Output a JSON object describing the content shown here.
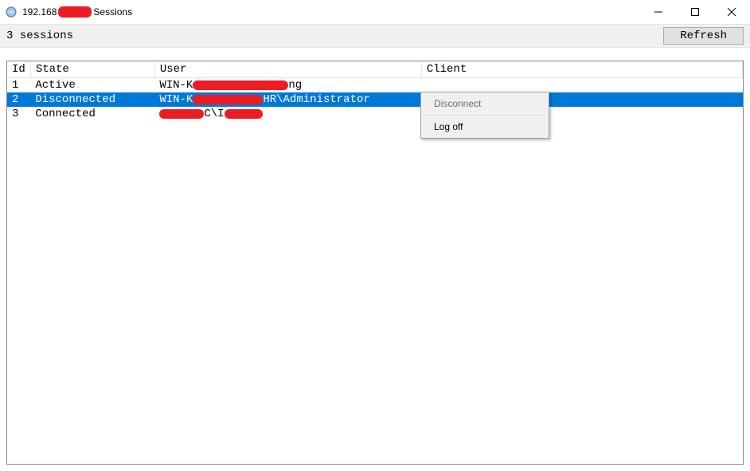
{
  "window": {
    "ip_prefix": "192.168",
    "title_suffix": " Sessions"
  },
  "toolbar": {
    "session_count_label": "3 sessions",
    "refresh_label": "Refresh"
  },
  "columns": {
    "id": "Id",
    "state": "State",
    "user": "User",
    "client": "Client"
  },
  "rows": [
    {
      "id": "1",
      "state": "Active",
      "user_prefix": "WIN-K",
      "user_suffix": "ng",
      "client": "",
      "selected": false
    },
    {
      "id": "2",
      "state": "Disconnected",
      "user_prefix": "WIN-K",
      "user_suffix": "HR\\Administrator",
      "client": "",
      "selected": true
    },
    {
      "id": "3",
      "state": "Connected",
      "user_prefix": "",
      "user_suffix": "",
      "client": "",
      "selected": false
    }
  ],
  "context_menu": {
    "disconnect": "Disconnect",
    "logoff": "Log off"
  },
  "redaction_color": "#ed1c24",
  "selection_color": "#0078d7"
}
